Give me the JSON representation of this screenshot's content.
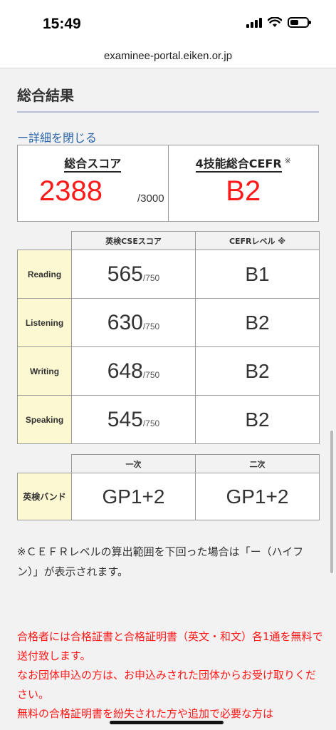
{
  "status": {
    "time": "15:49"
  },
  "browser": {
    "url": "examinee-portal.eiken.or.jp"
  },
  "section": {
    "title": "総合結果",
    "close_link": "ー詳細を閉じる"
  },
  "summary": {
    "score_label": "総合スコア",
    "score": "2388",
    "score_max": "/3000",
    "cefr_label": "4技能総合CEFR",
    "cefr_note": "※",
    "cefr": "B2"
  },
  "skills": {
    "col_cse": "英検CSEスコア",
    "col_cefr": "CEFRレベル ※",
    "rows": [
      {
        "name": "Reading",
        "score": "565",
        "max": "/750",
        "cefr": "B1"
      },
      {
        "name": "Listening",
        "score": "630",
        "max": "/750",
        "cefr": "B2"
      },
      {
        "name": "Writing",
        "score": "648",
        "max": "/750",
        "cefr": "B2"
      },
      {
        "name": "Speaking",
        "score": "545",
        "max": "/750",
        "cefr": "B2"
      }
    ]
  },
  "band": {
    "col_first": "一次",
    "col_second": "二次",
    "label": "英検バンド",
    "first": "GP1+2",
    "second": "GP1+2"
  },
  "note": "※ＣＥＦＲレベルの算出範囲を下回った場合は「ー（ハイフン）」が表示されます。",
  "notice_lines": [
    "合格者には合格証書と合格証明書（英文・和文）各1通を無料で送付致します。",
    "なお団体申込の方は、お申込みされた団体からお受け取りください。",
    "無料の合格証明書を紛失された方や追加で必要な方は"
  ]
}
